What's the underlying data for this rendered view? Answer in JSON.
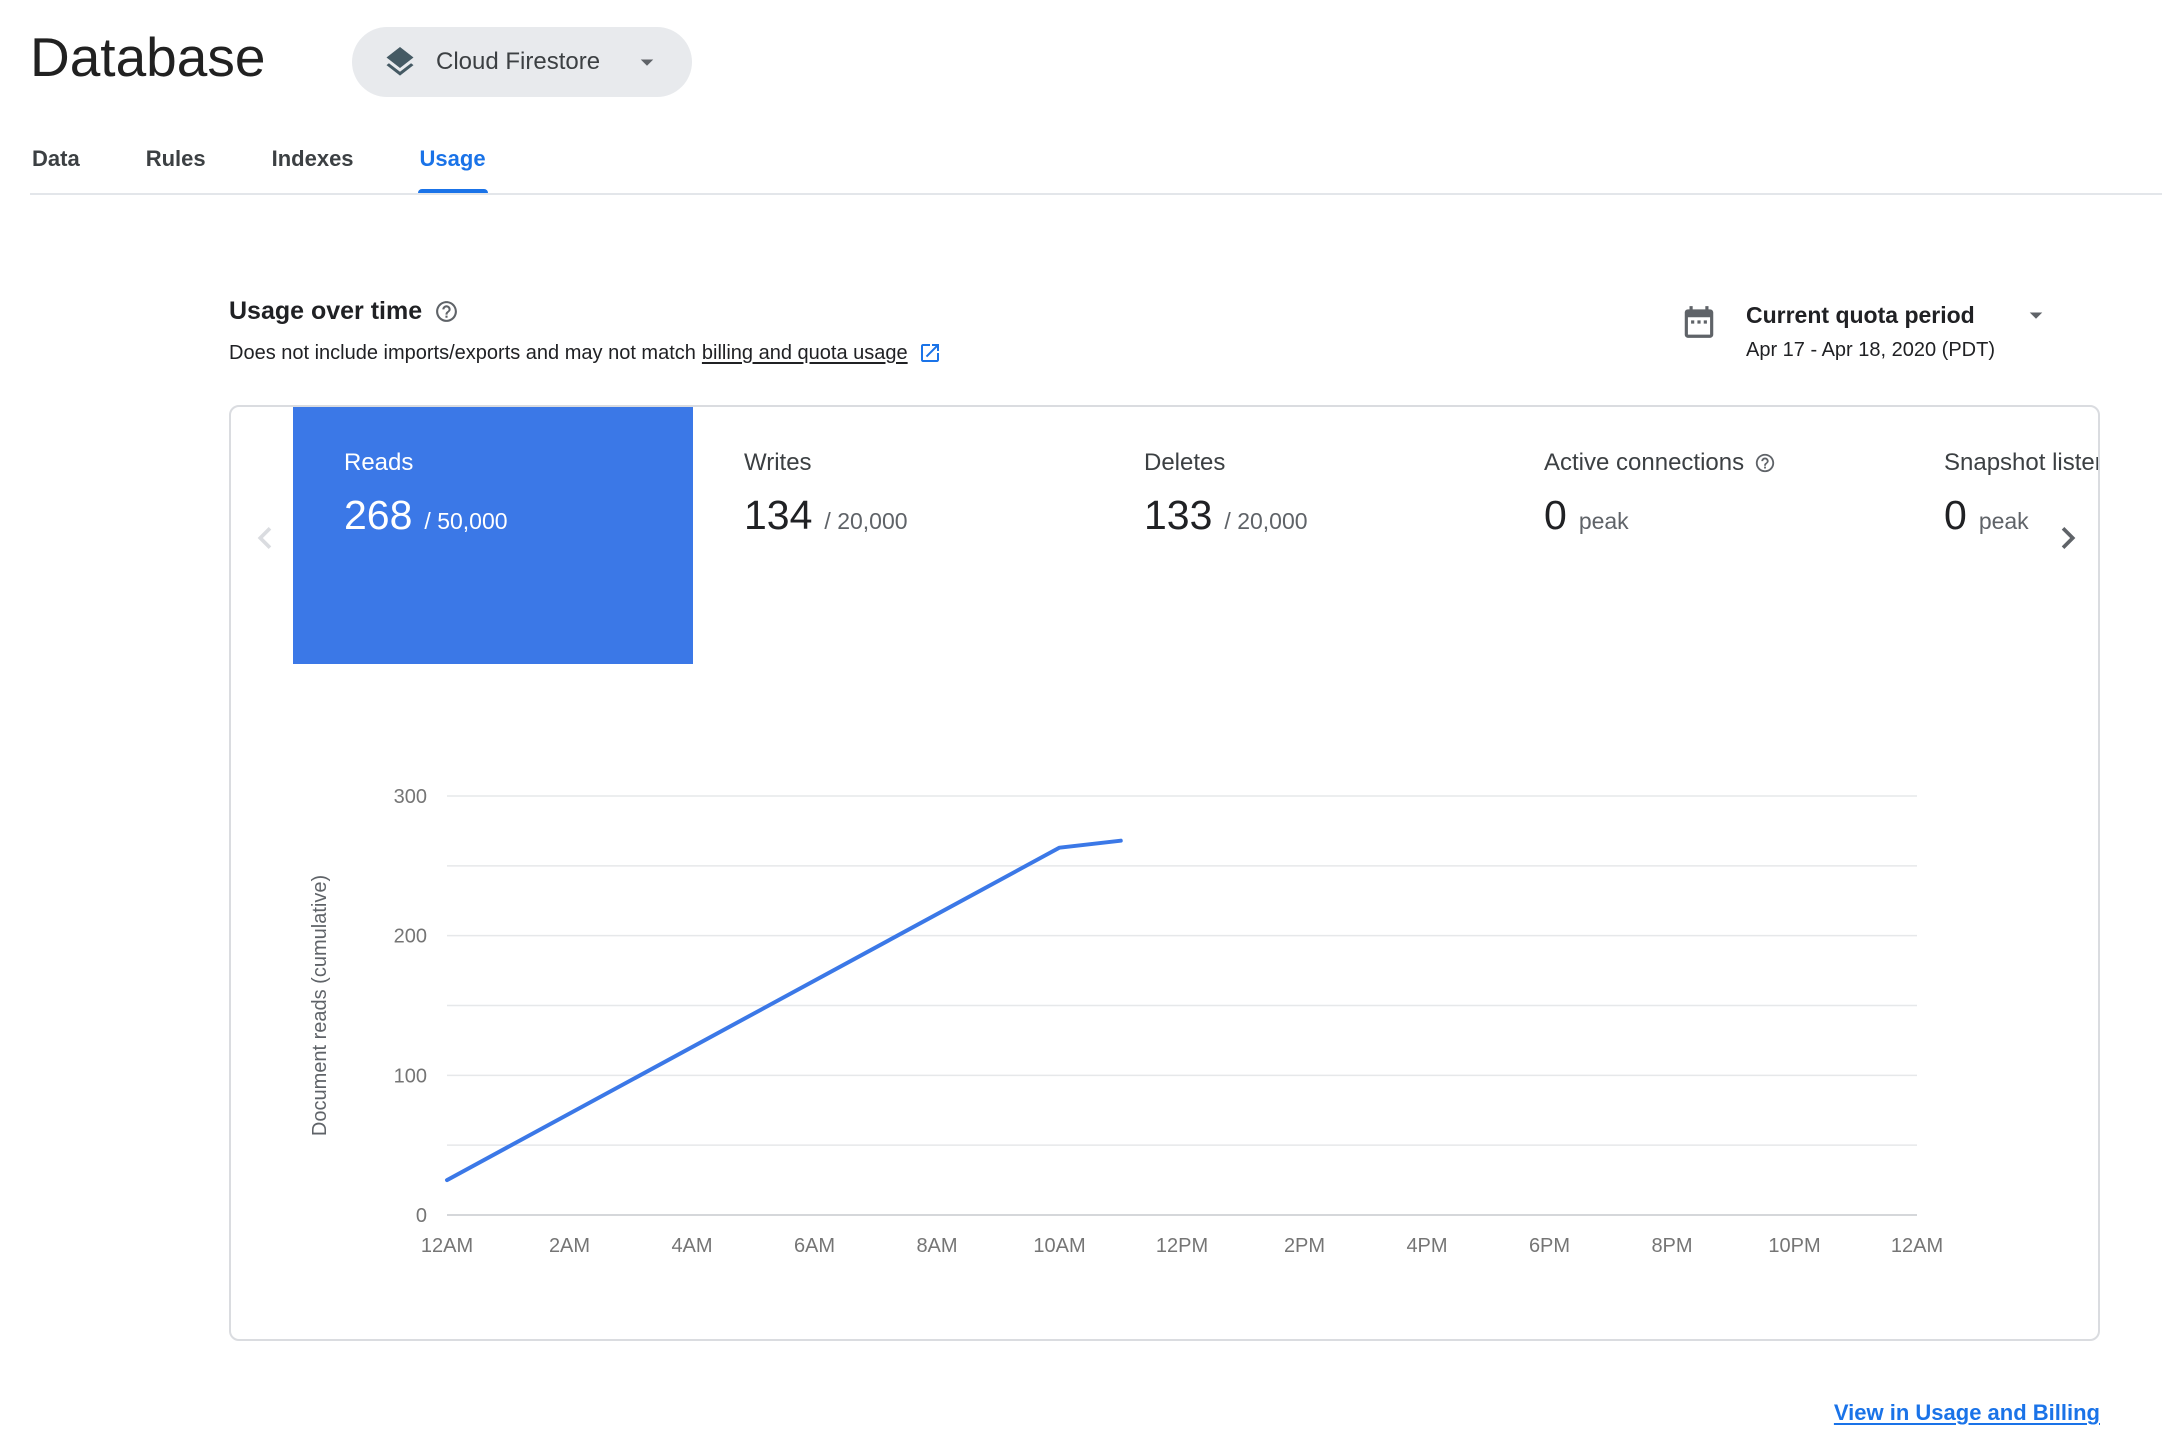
{
  "header": {
    "title": "Database",
    "product_selector": {
      "label": "Cloud Firestore"
    }
  },
  "tabs": [
    {
      "label": "Data",
      "active": false
    },
    {
      "label": "Rules",
      "active": false
    },
    {
      "label": "Indexes",
      "active": false
    },
    {
      "label": "Usage",
      "active": true
    }
  ],
  "usage_header": {
    "title": "Usage over time",
    "subtitle_prefix": "Does not include imports/exports and may not match",
    "subtitle_link": "billing and quota usage",
    "period_selector": {
      "label": "Current quota period",
      "range": "Apr 17 - Apr 18, 2020 (PDT)"
    }
  },
  "metrics": [
    {
      "label": "Reads",
      "value": "268",
      "quota": "/ 50,000",
      "selected": true
    },
    {
      "label": "Writes",
      "value": "134",
      "quota": "/ 20,000",
      "selected": false
    },
    {
      "label": "Deletes",
      "value": "133",
      "quota": "/ 20,000",
      "selected": false
    },
    {
      "label": "Active connections",
      "value": "0",
      "quota": "peak",
      "selected": false,
      "has_help": true
    },
    {
      "label": "Snapshot listeners",
      "value": "0",
      "quota": "peak",
      "selected": false
    }
  ],
  "chart_data": {
    "type": "line",
    "title": "",
    "xlabel": "",
    "ylabel": "Document reads (cumulative)",
    "x_range_hours": [
      0,
      24
    ],
    "x_ticks": [
      "12AM",
      "2AM",
      "4AM",
      "6AM",
      "8AM",
      "10AM",
      "12PM",
      "2PM",
      "4PM",
      "6PM",
      "8PM",
      "10PM",
      "12AM"
    ],
    "ylim": [
      0,
      300
    ],
    "y_ticks": [
      0,
      100,
      200,
      300
    ],
    "gridline_step": 50,
    "grid": true,
    "legend": "none",
    "series": [
      {
        "name": "Reads (cumulative)",
        "color": "#3b78e7",
        "points": [
          [
            0,
            25
          ],
          [
            10,
            263
          ],
          [
            11,
            268
          ]
        ]
      }
    ]
  },
  "footer": {
    "link": "View in Usage and Billing"
  },
  "colors": {
    "accent_blue": "#1a73e8",
    "selected_tile_blue": "#3b78e7",
    "text_primary": "#202124",
    "text_secondary": "#5f6368",
    "border": "#dadce0",
    "gridline": "#e3e3e3"
  },
  "icons": {
    "product": "firestore-icon",
    "dropdown": "arrow-drop-down-icon",
    "help": "help-icon",
    "external_link": "open-in-new-icon",
    "calendar": "calendar-icon",
    "prev": "chevron-left-icon",
    "next": "chevron-right-icon"
  }
}
